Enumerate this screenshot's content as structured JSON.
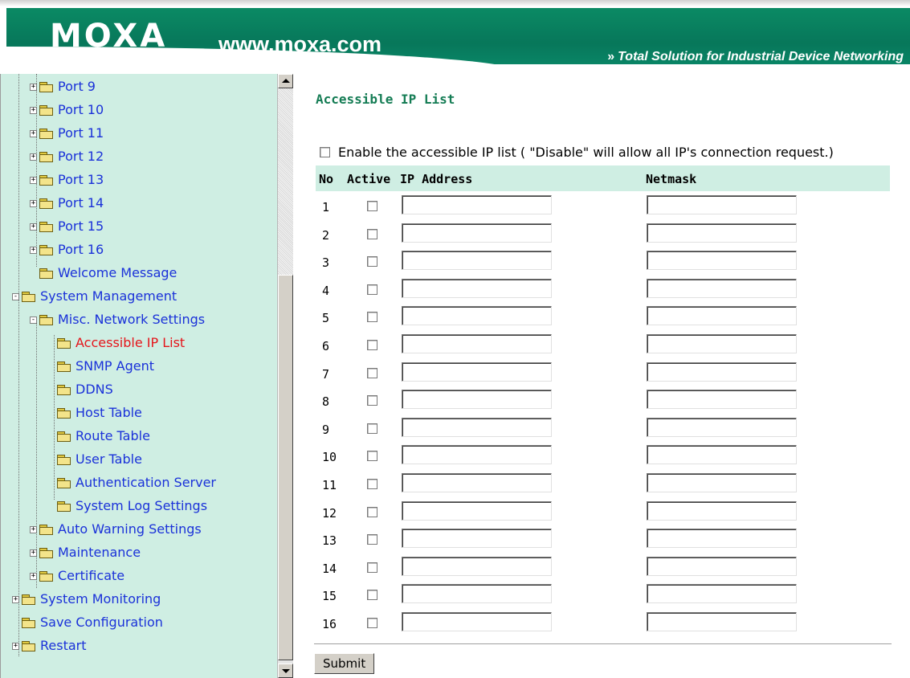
{
  "header": {
    "logo": "MOXA",
    "url": "www.moxa.com",
    "tagline": "Total Solution for Industrial Device Networking",
    "tagline_chevron": "»"
  },
  "sidebar": {
    "items": [
      {
        "label": "Port 9",
        "state": "collapsed"
      },
      {
        "label": "Port 10",
        "state": "collapsed"
      },
      {
        "label": "Port 11",
        "state": "collapsed"
      },
      {
        "label": "Port 12",
        "state": "collapsed"
      },
      {
        "label": "Port 13",
        "state": "collapsed"
      },
      {
        "label": "Port 14",
        "state": "collapsed"
      },
      {
        "label": "Port 15",
        "state": "collapsed"
      },
      {
        "label": "Port 16",
        "state": "collapsed"
      },
      {
        "label": "Welcome Message",
        "state": "leaf"
      },
      {
        "label": "System Management",
        "state": "expanded"
      },
      {
        "label": "Misc. Network Settings",
        "state": "expanded"
      },
      {
        "label": "Accessible IP List",
        "state": "leaf",
        "selected": true
      },
      {
        "label": "SNMP Agent",
        "state": "leaf"
      },
      {
        "label": "DDNS",
        "state": "leaf"
      },
      {
        "label": "Host Table",
        "state": "leaf"
      },
      {
        "label": "Route Table",
        "state": "leaf"
      },
      {
        "label": "User Table",
        "state": "leaf"
      },
      {
        "label": "Authentication Server",
        "state": "leaf"
      },
      {
        "label": "System Log Settings",
        "state": "leaf"
      },
      {
        "label": "Auto Warning Settings",
        "state": "collapsed"
      },
      {
        "label": "Maintenance",
        "state": "collapsed"
      },
      {
        "label": "Certificate",
        "state": "collapsed"
      },
      {
        "label": "System Monitoring",
        "state": "collapsed"
      },
      {
        "label": "Save Configuration",
        "state": "leaf"
      },
      {
        "label": "Restart",
        "state": "collapsed"
      }
    ]
  },
  "main": {
    "title": "Accessible IP List",
    "enable_label": "Enable the accessible IP list ( \"Disable\" will allow all IP's connection request.)",
    "enable_checked": false,
    "columns": {
      "no": "No",
      "active": "Active",
      "ip": "IP Address",
      "netmask": "Netmask"
    },
    "rows": [
      {
        "no": "1",
        "active": false,
        "ip": "",
        "netmask": ""
      },
      {
        "no": "2",
        "active": false,
        "ip": "",
        "netmask": ""
      },
      {
        "no": "3",
        "active": false,
        "ip": "",
        "netmask": ""
      },
      {
        "no": "4",
        "active": false,
        "ip": "",
        "netmask": ""
      },
      {
        "no": "5",
        "active": false,
        "ip": "",
        "netmask": ""
      },
      {
        "no": "6",
        "active": false,
        "ip": "",
        "netmask": ""
      },
      {
        "no": "7",
        "active": false,
        "ip": "",
        "netmask": ""
      },
      {
        "no": "8",
        "active": false,
        "ip": "",
        "netmask": ""
      },
      {
        "no": "9",
        "active": false,
        "ip": "",
        "netmask": ""
      },
      {
        "no": "10",
        "active": false,
        "ip": "",
        "netmask": ""
      },
      {
        "no": "11",
        "active": false,
        "ip": "",
        "netmask": ""
      },
      {
        "no": "12",
        "active": false,
        "ip": "",
        "netmask": ""
      },
      {
        "no": "13",
        "active": false,
        "ip": "",
        "netmask": ""
      },
      {
        "no": "14",
        "active": false,
        "ip": "",
        "netmask": ""
      },
      {
        "no": "15",
        "active": false,
        "ip": "",
        "netmask": ""
      },
      {
        "no": "16",
        "active": false,
        "ip": "",
        "netmask": ""
      }
    ],
    "submit_label": "Submit"
  },
  "colors": {
    "brand_green": "#07775a",
    "sidebar_bg": "#cfeee3",
    "link_blue": "#1a31d9",
    "selected_red": "#e5141a",
    "title_green": "#147c54"
  }
}
